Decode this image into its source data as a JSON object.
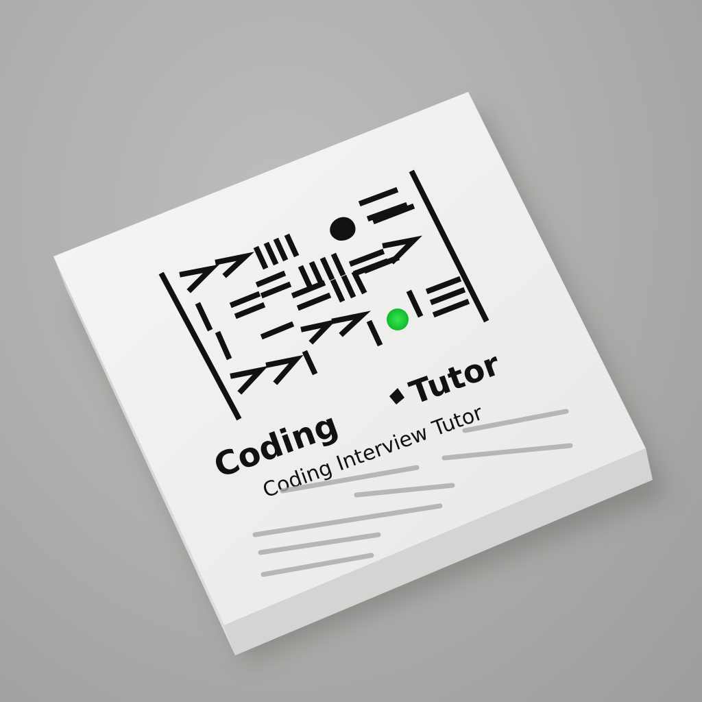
{
  "canvas": {
    "background_color": "#acacaa",
    "card_color": "#f2f2f1",
    "ink_color": "#111111",
    "accent_color": "#1fd13a"
  },
  "logo": {
    "title": "Coding",
    "title_tail": "Tutor",
    "subtitle": "Coding Interview Tutor",
    "accent_icon": "green-dot-icon"
  }
}
